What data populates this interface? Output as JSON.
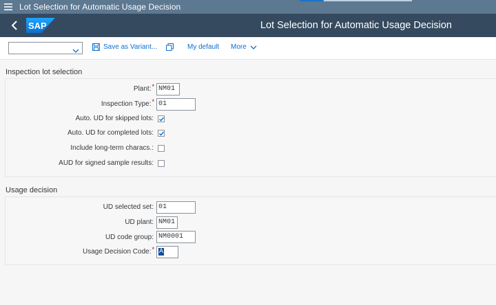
{
  "window": {
    "title": "Lot Selection for Automatic Usage Decision",
    "menu_icon": "hamburger-icon"
  },
  "shell": {
    "title": "Lot Selection for Automatic Usage Decision",
    "logo_text": "SAP",
    "back_icon": "back-arrow-icon"
  },
  "toolbar": {
    "variant_value": "",
    "save_variant": "Save as Variant...",
    "my_default": "My default",
    "more": "More"
  },
  "lot_selection": {
    "title": "Inspection lot selection",
    "plant_label": "Plant:",
    "plant_value": "NM01",
    "inspection_type_label": "Inspection Type:",
    "inspection_type_value": "01",
    "skipped_label": "Auto. UD for skipped lots:",
    "skipped_checked": true,
    "completed_label": "Auto. UD for completed lots:",
    "completed_checked": true,
    "longterm_label": "Include long-term characs.:",
    "longterm_checked": false,
    "signed_label": "AUD for signed sample results:",
    "signed_checked": false
  },
  "usage_decision": {
    "title": "Usage decision",
    "selected_set_label": "UD selected set:",
    "selected_set_value": "01",
    "plant_label": "UD plant:",
    "plant_value": "NM01",
    "code_group_label": "UD code group:",
    "code_group_value": "NM0001",
    "code_label": "Usage Decision Code:",
    "code_value": "A"
  },
  "colors": {
    "shell": "#354a5f",
    "window_bar": "#5d7891",
    "link": "#0a6ed1",
    "required": "#bb0000"
  }
}
